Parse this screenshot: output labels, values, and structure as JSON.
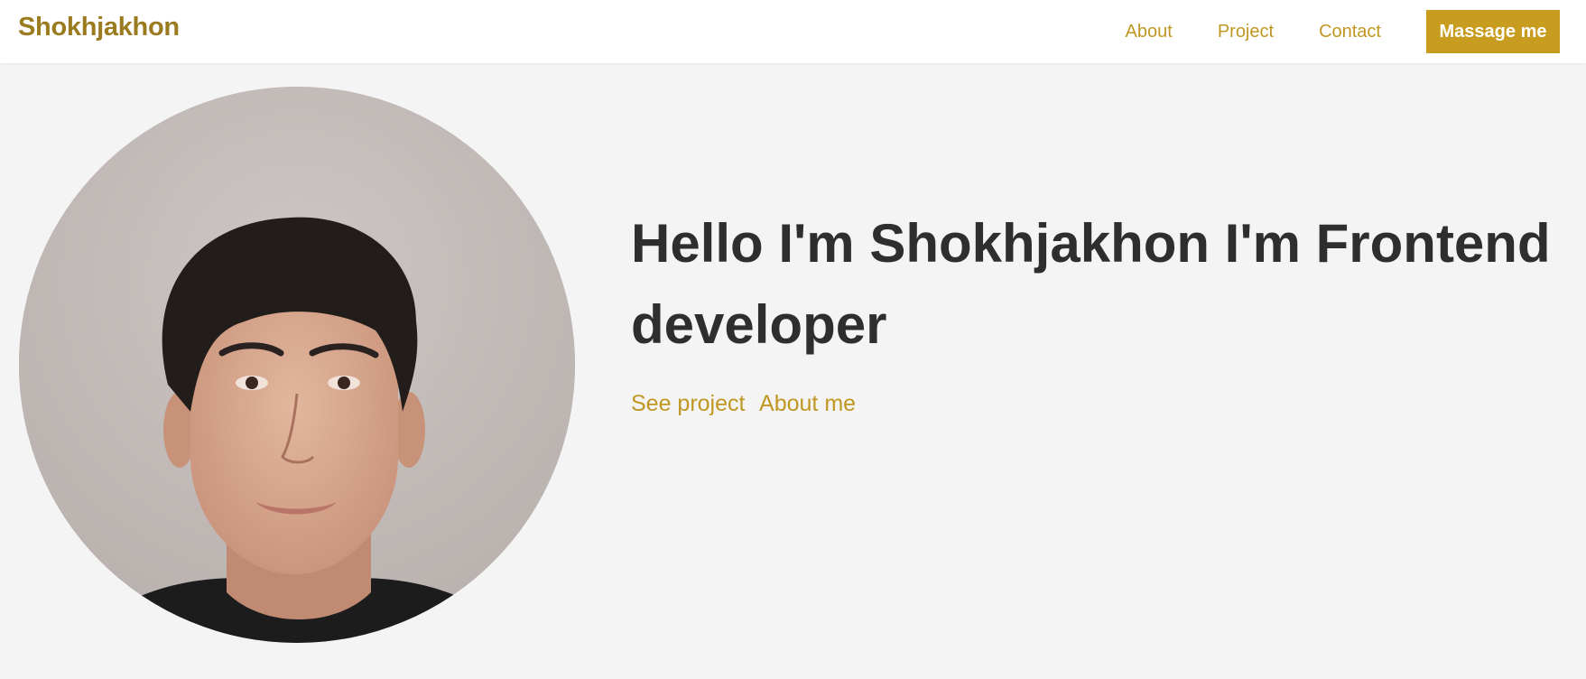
{
  "header": {
    "logo": "Shokhjakhon",
    "nav": [
      {
        "label": "About"
      },
      {
        "label": "Project"
      },
      {
        "label": "Contact"
      }
    ],
    "cta_label": "Massage me"
  },
  "hero": {
    "headline": "Hello I'm Shokhjakhon I'm Frontend developer",
    "links": [
      {
        "label": "See project"
      },
      {
        "label": "About me"
      }
    ],
    "avatar_icon": "profile-photo"
  },
  "colors": {
    "brand": "#9b7b1f",
    "accent": "#c89d1f",
    "link": "#bf9722",
    "heading": "#2e2e2e",
    "background": "#f4f4f4"
  }
}
